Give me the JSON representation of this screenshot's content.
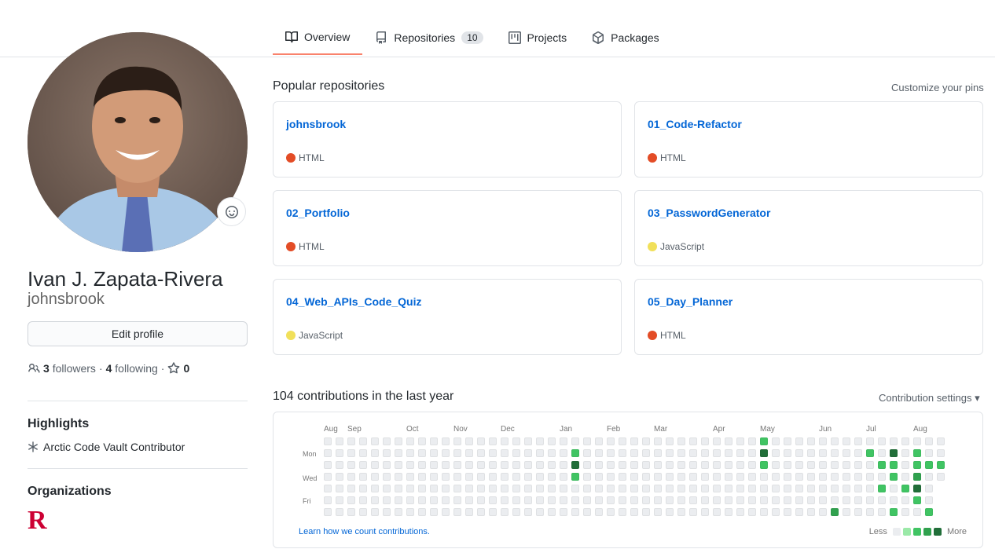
{
  "tabs": [
    {
      "label": "Overview",
      "icon": "book-icon",
      "active": true
    },
    {
      "label": "Repositories",
      "icon": "repo-icon",
      "count": "10"
    },
    {
      "label": "Projects",
      "icon": "project-icon"
    },
    {
      "label": "Packages",
      "icon": "package-icon"
    }
  ],
  "profile": {
    "fullname": "Ivan J. Zapata-Rivera",
    "username": "johnsbrook",
    "edit_label": "Edit profile",
    "followers_count": "3",
    "followers_label": "followers",
    "following_count": "4",
    "following_label": "following",
    "stars_count": "0"
  },
  "highlights": {
    "title": "Highlights",
    "items": [
      "Arctic Code Vault Contributor"
    ]
  },
  "organizations": {
    "title": "Organizations",
    "logo_letter": "R"
  },
  "popular": {
    "title": "Popular repositories",
    "customize": "Customize your pins",
    "repos": [
      {
        "name": "johnsbrook",
        "lang": "HTML",
        "color": "#e34c26"
      },
      {
        "name": "01_Code-Refactor",
        "lang": "HTML",
        "color": "#e34c26"
      },
      {
        "name": "02_Portfolio",
        "lang": "HTML",
        "color": "#e34c26"
      },
      {
        "name": "03_PasswordGenerator",
        "lang": "JavaScript",
        "color": "#f1e05a"
      },
      {
        "name": "04_Web_APIs_Code_Quiz",
        "lang": "JavaScript",
        "color": "#f1e05a"
      },
      {
        "name": "05_Day_Planner",
        "lang": "HTML",
        "color": "#e34c26"
      }
    ]
  },
  "contrib": {
    "title": "104 contributions in the last year",
    "settings": "Contribution settings",
    "months": [
      "Aug",
      "Sep",
      "Oct",
      "Nov",
      "Dec",
      "Jan",
      "Feb",
      "Mar",
      "Apr",
      "May",
      "Jun",
      "Jul",
      "Aug"
    ],
    "day_labels": [
      "Mon",
      "Wed",
      "Fri"
    ],
    "learn": "Learn how we count contributions.",
    "less": "Less",
    "more": "More",
    "colors": [
      "#ebedf0",
      "#9be9a8",
      "#40c463",
      "#30a14e",
      "#216e39"
    ],
    "weeks": 53,
    "active_cells": [
      {
        "week": 21,
        "day": 1,
        "level": 2
      },
      {
        "week": 21,
        "day": 2,
        "level": 4
      },
      {
        "week": 21,
        "day": 3,
        "level": 2
      },
      {
        "week": 37,
        "day": 0,
        "level": 2
      },
      {
        "week": 37,
        "day": 1,
        "level": 4
      },
      {
        "week": 37,
        "day": 2,
        "level": 2
      },
      {
        "week": 43,
        "day": 6,
        "level": 3
      },
      {
        "week": 46,
        "day": 1,
        "level": 2
      },
      {
        "week": 47,
        "day": 2,
        "level": 2
      },
      {
        "week": 47,
        "day": 4,
        "level": 2
      },
      {
        "week": 48,
        "day": 1,
        "level": 4
      },
      {
        "week": 48,
        "day": 2,
        "level": 2
      },
      {
        "week": 48,
        "day": 3,
        "level": 2
      },
      {
        "week": 48,
        "day": 6,
        "level": 2
      },
      {
        "week": 49,
        "day": 4,
        "level": 2
      },
      {
        "week": 50,
        "day": 1,
        "level": 2
      },
      {
        "week": 50,
        "day": 2,
        "level": 2
      },
      {
        "week": 50,
        "day": 3,
        "level": 3
      },
      {
        "week": 50,
        "day": 4,
        "level": 4
      },
      {
        "week": 50,
        "day": 5,
        "level": 2
      },
      {
        "week": 51,
        "day": 2,
        "level": 2
      },
      {
        "week": 51,
        "day": 6,
        "level": 2
      },
      {
        "week": 52,
        "day": 2,
        "level": 2
      }
    ]
  }
}
